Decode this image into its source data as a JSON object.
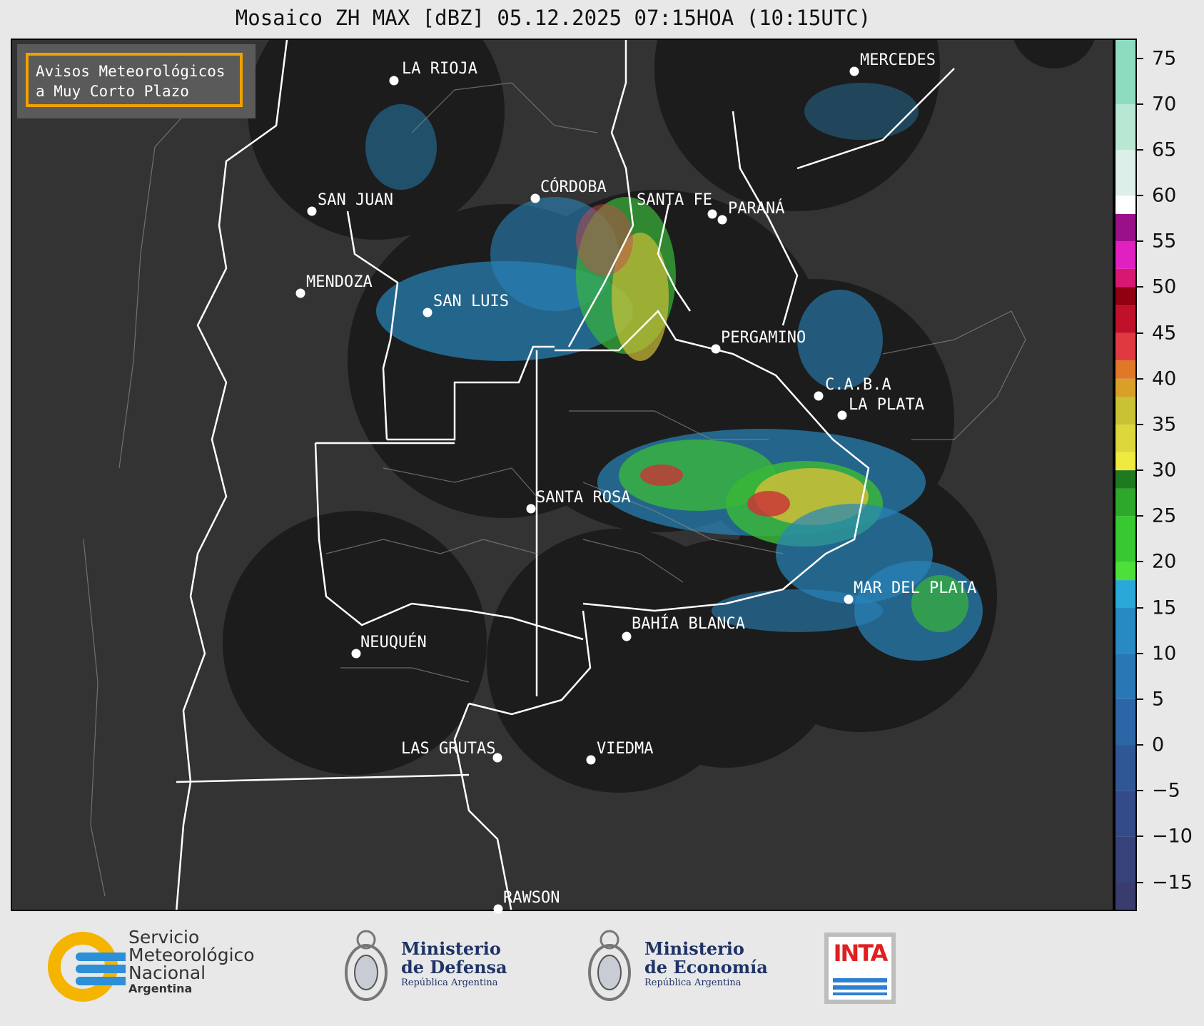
{
  "title": "Mosaico ZH MAX [dBZ] 05.12.2025 07:15HOA (10:15UTC)",
  "warning_box": "Avisos Meteorológicos\na Muy Corto Plazo",
  "cities": [
    {
      "name": "LA RIOJA"
    },
    {
      "name": "MERCEDES"
    },
    {
      "name": "SAN JUAN"
    },
    {
      "name": "CÓRDOBA"
    },
    {
      "name": "SANTA FE"
    },
    {
      "name": "PARANÁ"
    },
    {
      "name": "MENDOZA"
    },
    {
      "name": "SAN LUIS"
    },
    {
      "name": "PERGAMINO"
    },
    {
      "name": "C.A.B.A"
    },
    {
      "name": "LA PLATA"
    },
    {
      "name": "SANTA ROSA"
    },
    {
      "name": "MAR DEL PLATA"
    },
    {
      "name": "BAHÍA BLANCA"
    },
    {
      "name": "NEUQUÉN"
    },
    {
      "name": "LAS GRUTAS"
    },
    {
      "name": "VIEDMA"
    },
    {
      "name": "RAWSON"
    }
  ],
  "colorbar": {
    "unit": "dBZ",
    "min": -18,
    "max": 77,
    "ticks": [
      "75",
      "70",
      "65",
      "60",
      "55",
      "50",
      "45",
      "40",
      "35",
      "30",
      "25",
      "20",
      "15",
      "10",
      "5",
      "0",
      "−5",
      "−10",
      "−15"
    ],
    "tick_values": [
      75,
      70,
      65,
      60,
      55,
      50,
      45,
      40,
      35,
      30,
      25,
      20,
      15,
      10,
      5,
      0,
      -5,
      -10,
      -15
    ]
  },
  "logos": {
    "smn": {
      "line1": "Servicio",
      "line2": "Meteorológico",
      "line3": "Nacional",
      "line4": "Argentina"
    },
    "defensa": {
      "line1": "Ministerio",
      "line2": "de Defensa",
      "line3": "República Argentina"
    },
    "economia": {
      "line1": "Ministerio",
      "line2": "de Economía",
      "line3": "República Argentina"
    },
    "inta": {
      "text": "INTA"
    }
  },
  "colors": {
    "map_bg": "#333333",
    "radar_coverage": "#1c1c1c",
    "border_white": "#ffffff",
    "warning_border": "#f0a000"
  }
}
